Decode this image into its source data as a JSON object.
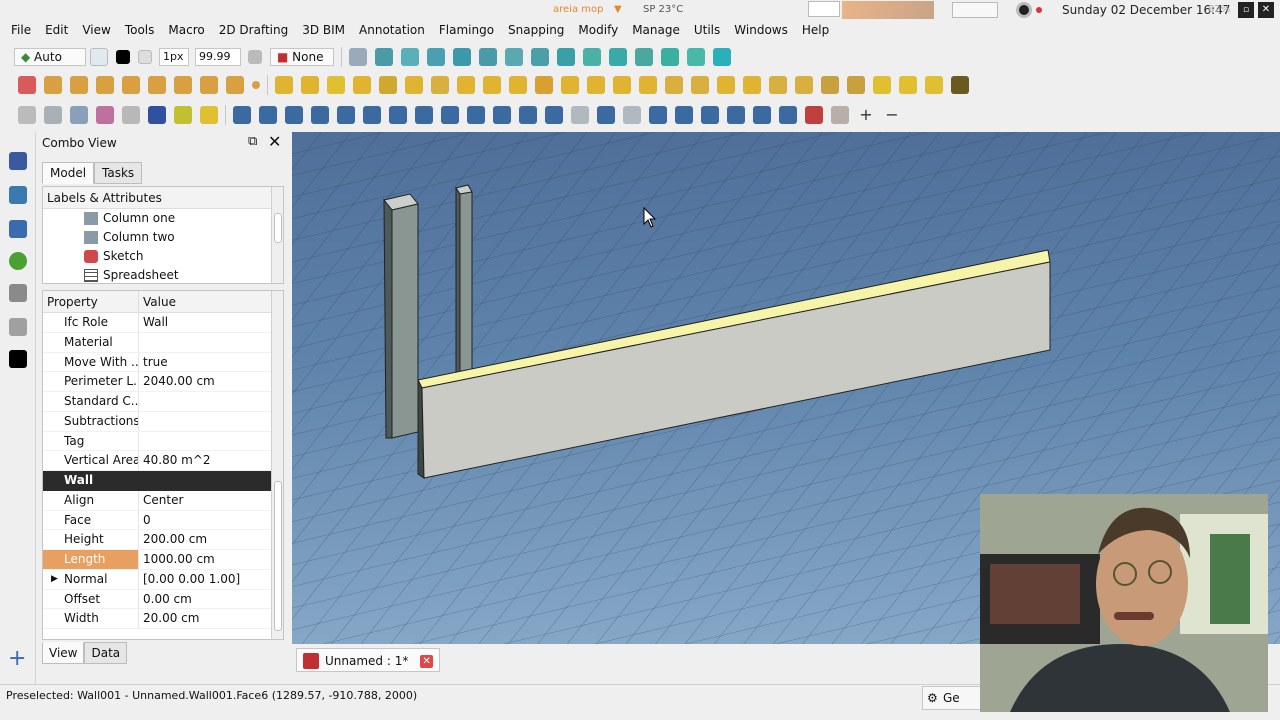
{
  "menubar": {
    "items": [
      "File",
      "Edit",
      "View",
      "Tools",
      "Macro",
      "2D Drafting",
      "3D BIM",
      "Annotation",
      "Flamingo",
      "Snapping",
      "Modify",
      "Manage",
      "Utils",
      "Windows",
      "Help"
    ],
    "tray_app": "areia mop",
    "weather": "SP 23°C",
    "datetime": "Sunday 02 December 16:47",
    "battery": "82%"
  },
  "toolbar1": {
    "auto_label": "Auto",
    "linewidth": "1px",
    "fontsize": "99.99",
    "none_label": "None"
  },
  "combo": {
    "title": "Combo View",
    "tabs": [
      "Model",
      "Tasks"
    ],
    "bottom_tabs": [
      "View",
      "Data"
    ],
    "tree_header": "Labels & Attributes",
    "tree_items": [
      {
        "label": "Column one",
        "icon": "column-icon"
      },
      {
        "label": "Column two",
        "icon": "column-icon"
      },
      {
        "label": "Sketch",
        "icon": "sketch-icon"
      },
      {
        "label": "Spreadsheet",
        "icon": "spreadsheet-icon"
      }
    ],
    "prop_header": {
      "property": "Property",
      "value": "Value"
    },
    "props_top": [
      {
        "name": "Ifc Role",
        "value": "Wall"
      },
      {
        "name": "Material",
        "value": ""
      },
      {
        "name": "Move With ...",
        "value": "true"
      },
      {
        "name": "Perimeter L...",
        "value": "2040.00 cm"
      },
      {
        "name": "Standard C...",
        "value": ""
      },
      {
        "name": "Subtractions",
        "value": ""
      },
      {
        "name": "Tag",
        "value": ""
      },
      {
        "name": "Vertical Area",
        "value": "40.80 m^2"
      }
    ],
    "group_label": "Wall",
    "props_wall": [
      {
        "name": "Align",
        "value": "Center"
      },
      {
        "name": "Face",
        "value": "0"
      },
      {
        "name": "Height",
        "value": "200.00 cm"
      },
      {
        "name": "Length",
        "value": "1000.00 cm"
      },
      {
        "name": "Normal",
        "value": "[0.00 0.00 1.00]"
      },
      {
        "name": "Offset",
        "value": "0.00 cm"
      },
      {
        "name": "Width",
        "value": "20.00 cm"
      }
    ]
  },
  "document": {
    "tab_label": "Unnamed : 1*",
    "close_symbol": "✕"
  },
  "status": {
    "text": "Preselected: Wall001 - Unnamed.Wall001.Face6 (1289.57, -910.788, 2000)",
    "nav_label": "Ge"
  },
  "colors": {
    "selected_row": "#e8a060",
    "wall_top_highlight": "#f6f4a8",
    "viewport_top": "#4f6f99",
    "viewport_bottom": "#86a7c6"
  }
}
